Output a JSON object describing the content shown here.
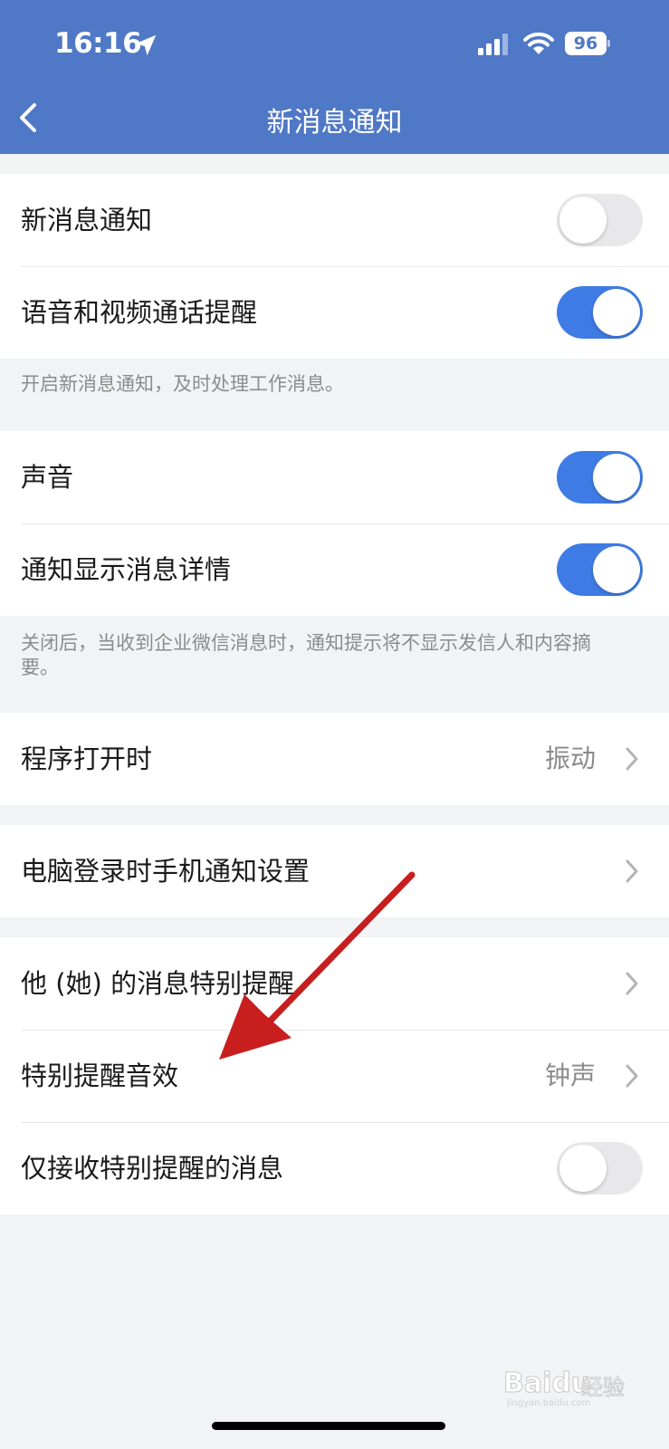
{
  "status_bar": {
    "time": "16:16",
    "battery": "96"
  },
  "nav": {
    "title": "新消息通知"
  },
  "group1": {
    "rows": [
      {
        "label": "新消息通知",
        "toggle": "off"
      },
      {
        "label": "语音和视频通话提醒",
        "toggle": "on"
      }
    ],
    "note": "开启新消息通知，及时处理工作消息。"
  },
  "group2": {
    "rows": [
      {
        "label": "声音",
        "toggle": "on"
      },
      {
        "label": "通知显示消息详情",
        "toggle": "on"
      }
    ],
    "note": "关闭后，当收到企业微信消息时，通知提示将不显示发信人和内容摘要。"
  },
  "group3": {
    "rows": [
      {
        "label": "程序打开时",
        "value": "振动"
      }
    ]
  },
  "group4": {
    "rows": [
      {
        "label": "电脑登录时手机通知设置"
      }
    ]
  },
  "group5": {
    "rows": [
      {
        "label": "他 (她) 的消息特别提醒"
      },
      {
        "label": "特别提醒音效",
        "value": "钟声"
      },
      {
        "label": "仅接收特别提醒的消息",
        "toggle": "off"
      }
    ]
  },
  "watermark": {
    "brand": "Bai",
    "brand2": "du",
    "suffix": "经验",
    "url": "jingyan.baidu.com"
  },
  "colors": {
    "header": "#4f78c6",
    "toggle_on": "#3f7be4",
    "toggle_off": "#e8e8ea",
    "annotation_arrow": "#c81e1e"
  }
}
